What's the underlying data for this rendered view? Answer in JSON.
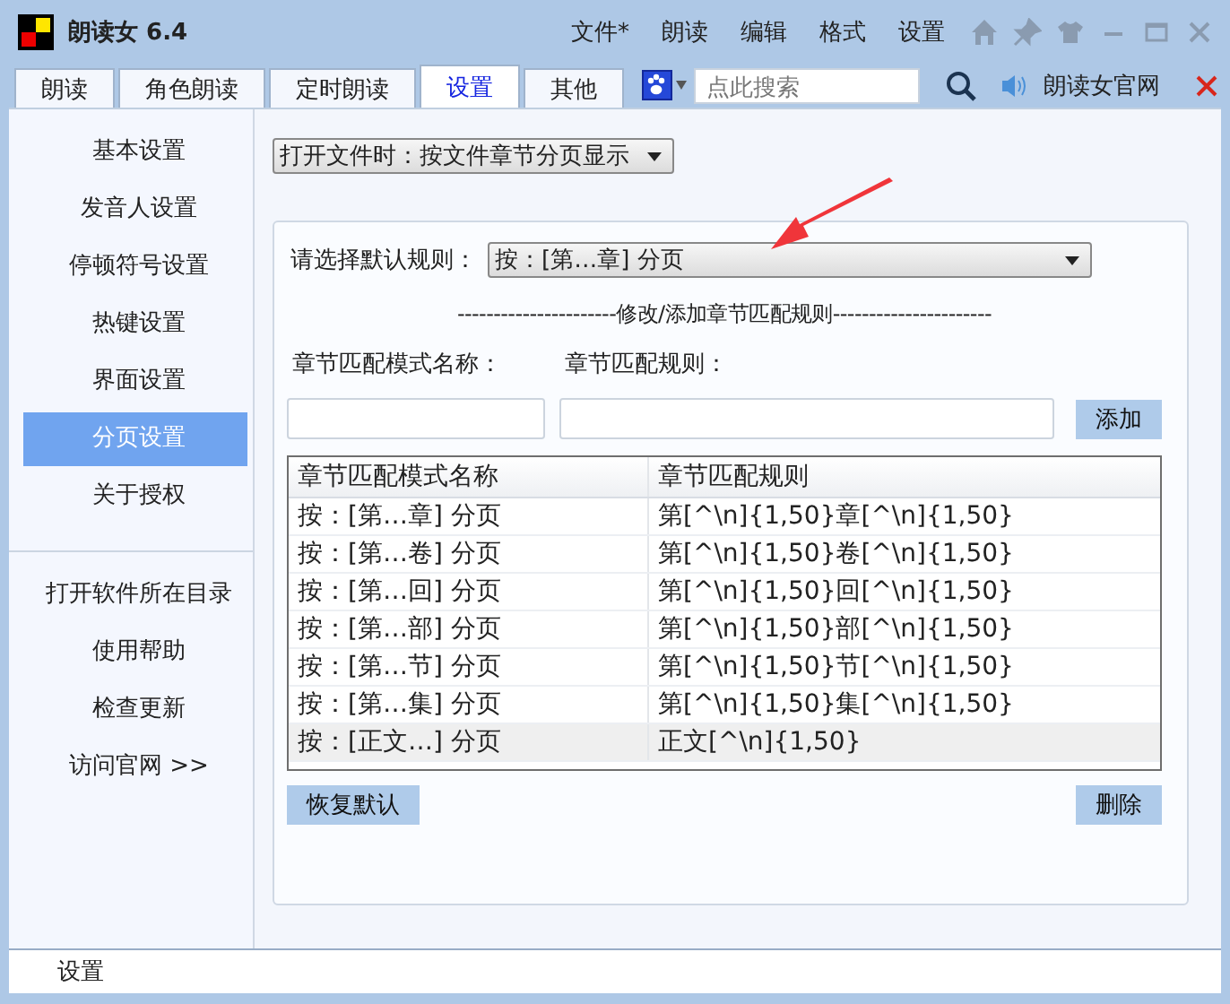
{
  "window": {
    "title": "朗读女 6.4",
    "menu": [
      "文件*",
      "朗读",
      "编辑",
      "格式",
      "设置"
    ]
  },
  "tabs": [
    {
      "label": "朗读",
      "selected": false
    },
    {
      "label": "角色朗读",
      "selected": false
    },
    {
      "label": "定时朗读",
      "selected": false
    },
    {
      "label": "设置",
      "selected": true
    },
    {
      "label": "其他",
      "selected": false
    }
  ],
  "search": {
    "placeholder": "点此搜索"
  },
  "site_link": "朗读女官网",
  "sidebar": {
    "items": [
      {
        "label": "基本设置",
        "selected": false
      },
      {
        "label": "发音人设置",
        "selected": false
      },
      {
        "label": "停顿符号设置",
        "selected": false
      },
      {
        "label": "热键设置",
        "selected": false
      },
      {
        "label": "界面设置",
        "selected": false
      },
      {
        "label": "分页设置",
        "selected": true
      },
      {
        "label": "关于授权",
        "selected": false
      }
    ],
    "links": [
      "打开软件所在目录",
      "使用帮助",
      "检查更新",
      "访问官网 >>"
    ]
  },
  "open_file_mode": "打开文件时：按文件章节分页显示",
  "rule_panel": {
    "default_rule_label": "请选择默认规则：",
    "default_rule": "按：[第…章] 分页",
    "section_title": "----------------------修改/添加章节匹配规则----------------------",
    "name_label": "章节匹配模式名称：",
    "rule_label": "章节匹配规则：",
    "add_button": "添加",
    "table": {
      "columns": [
        "章节匹配模式名称",
        "章节匹配规则"
      ],
      "rows": [
        {
          "cells": [
            "按：[第…章] 分页",
            "第[^\\n]{1,50}章[^\\n]{1,50}"
          ],
          "selected": false
        },
        {
          "cells": [
            "按：[第…卷] 分页",
            "第[^\\n]{1,50}卷[^\\n]{1,50}"
          ],
          "selected": false
        },
        {
          "cells": [
            "按：[第…回] 分页",
            "第[^\\n]{1,50}回[^\\n]{1,50}"
          ],
          "selected": false
        },
        {
          "cells": [
            "按：[第…部] 分页",
            "第[^\\n]{1,50}部[^\\n]{1,50}"
          ],
          "selected": false
        },
        {
          "cells": [
            "按：[第…节] 分页",
            "第[^\\n]{1,50}节[^\\n]{1,50}"
          ],
          "selected": false
        },
        {
          "cells": [
            "按：[第…集] 分页",
            "第[^\\n]{1,50}集[^\\n]{1,50}"
          ],
          "selected": false
        },
        {
          "cells": [
            "按：[正文…] 分页",
            "正文[^\\n]{1,50}"
          ],
          "selected": true
        }
      ]
    },
    "restore_button": "恢复默认",
    "delete_button": "删除"
  },
  "status_bar": "设置"
}
